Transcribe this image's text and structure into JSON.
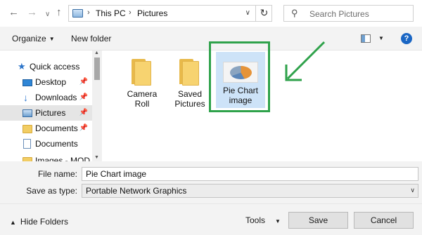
{
  "address_bar": {
    "back_icon": "arrow-left-icon",
    "forward_icon": "arrow-right-icon",
    "recent_icon": "chevron-down-icon",
    "up_icon": "arrow-up-icon",
    "location_icon": "pc-icon",
    "crumbs": [
      "This PC",
      "Pictures"
    ],
    "refresh_icon": "refresh-icon",
    "search_placeholder": "Search Pictures"
  },
  "toolbar": {
    "organize_label": "Organize",
    "new_folder_label": "New folder"
  },
  "nav": {
    "items": [
      {
        "label": "Quick access",
        "icon": "star-icon",
        "pinned": false
      },
      {
        "label": "Desktop",
        "icon": "desktop-icon",
        "pinned": true
      },
      {
        "label": "Downloads",
        "icon": "download-icon",
        "pinned": true
      },
      {
        "label": "Pictures",
        "icon": "pictures-icon",
        "pinned": true,
        "selected": true
      },
      {
        "label": "Documents",
        "icon": "folder-icon",
        "pinned": true
      },
      {
        "label": "Documents",
        "icon": "document-icon",
        "pinned": false
      },
      {
        "label": "Images - MOD f",
        "icon": "folder-icon",
        "pinned": false
      }
    ]
  },
  "content": {
    "items": [
      {
        "line1": "Camera",
        "line2": "Roll",
        "type": "folder"
      },
      {
        "line1": "Saved",
        "line2": "Pictures",
        "type": "folder"
      },
      {
        "line1": "Pie Chart",
        "line2": "image",
        "type": "image",
        "selected": true
      }
    ],
    "highlight_color": "#2fa24b"
  },
  "form": {
    "file_name_label": "File name:",
    "file_name_value": "Pie Chart image",
    "save_type_label": "Save as type:",
    "save_type_value": "Portable Network Graphics"
  },
  "footer": {
    "hide_folders_label": "Hide Folders",
    "tools_label": "Tools",
    "save_label": "Save",
    "cancel_label": "Cancel"
  }
}
